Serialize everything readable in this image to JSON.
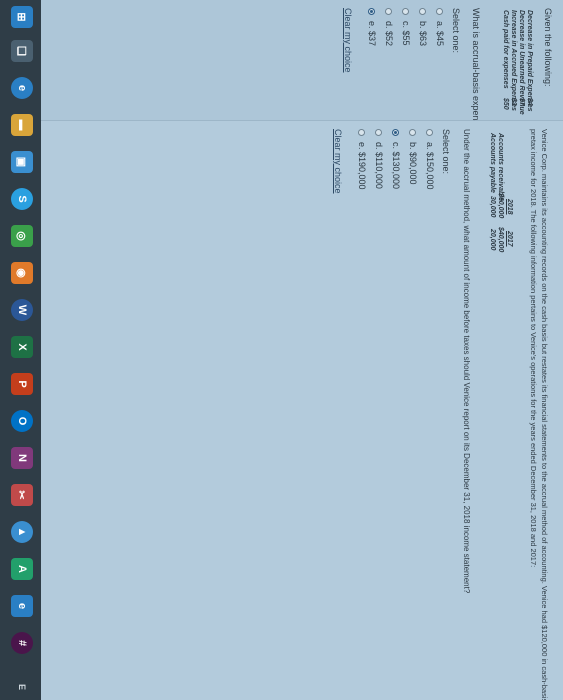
{
  "question1": {
    "title": "Given the following:",
    "table": [
      {
        "label": "Decrease in Prepaid Expenses",
        "value": "$4"
      },
      {
        "label": "Decrease in Unearned Revenue",
        "value": "$7"
      },
      {
        "label": "Increase in Accrued Expenses",
        "value": "$3"
      },
      {
        "label": "Cash paid for expenses",
        "value": "$50"
      }
    ],
    "prompt": "What is accrual-basis expenses?",
    "select_one": "Select one:",
    "options": [
      {
        "label": "a. $45",
        "selected": false
      },
      {
        "label": "b. $63",
        "selected": false
      },
      {
        "label": "c. $55",
        "selected": false
      },
      {
        "label": "d. $52",
        "selected": false
      },
      {
        "label": "e. $37",
        "selected": true
      }
    ],
    "clear": "Clear my choice"
  },
  "question2": {
    "stem_line1": "Venice Corp. maintains its accounting records on the cash basis but restates its financial statements to the accrual method of accounting. Venice had $120,000 in cash-basis",
    "stem_line2": "pretax income for 2018. The following information pertains to Venice's operations for the years ended December 31, 2018 and 2017:",
    "table": {
      "years": [
        "2018",
        "2017"
      ],
      "rows": [
        {
          "label": "Accounts receivable",
          "values": [
            "$60,000",
            "$40,000"
          ]
        },
        {
          "label": "Accounts payable",
          "values": [
            "30,000",
            "20,000"
          ]
        }
      ]
    },
    "prompt": "Under the accrual method, what amount of income before taxes should Venice report on its December 31, 2018 income statement?",
    "select_one": "Select one:",
    "options": [
      {
        "label": "a. $150,000",
        "selected": false
      },
      {
        "label": "b. $90,000",
        "selected": false
      },
      {
        "label": "c. $130,000",
        "selected": true
      },
      {
        "label": "d. $110,000",
        "selected": false
      },
      {
        "label": "e. $190,000",
        "selected": false
      }
    ],
    "clear": "Clear my choice"
  },
  "taskbar": {
    "icons": [
      {
        "name": "task-view-icon",
        "glyph": "❑",
        "color": "#4a6070"
      },
      {
        "name": "edge-icon",
        "glyph": "e",
        "color": "#2a7fc4"
      },
      {
        "name": "file-explorer-icon",
        "glyph": "▬",
        "color": "#d9a53a"
      },
      {
        "name": "store-icon",
        "glyph": "▣",
        "color": "#3a8fd0"
      },
      {
        "name": "skype-icon",
        "glyph": "S",
        "color": "#2aa0e0"
      },
      {
        "name": "chrome-icon",
        "glyph": "◎",
        "color": "#3aa04a"
      },
      {
        "name": "firefox-icon",
        "glyph": "◉",
        "color": "#e07a2a"
      },
      {
        "name": "word-icon",
        "glyph": "W",
        "color": "#2b5797"
      },
      {
        "name": "excel-icon",
        "glyph": "X",
        "color": "#1e7145"
      },
      {
        "name": "powerpoint-icon",
        "glyph": "P",
        "color": "#c43e1c"
      },
      {
        "name": "outlook-icon",
        "glyph": "O",
        "color": "#0072c6"
      },
      {
        "name": "onenote-icon",
        "glyph": "N",
        "color": "#80397b"
      },
      {
        "name": "snipping-icon",
        "glyph": "✂",
        "color": "#c04a4a"
      },
      {
        "name": "photos-icon",
        "glyph": "▲",
        "color": "#3a8fd0"
      },
      {
        "name": "app-icon",
        "glyph": "A",
        "color": "#22a06b"
      },
      {
        "name": "browser-icon",
        "glyph": "e",
        "color": "#2a7fc4"
      },
      {
        "name": "slack-icon",
        "glyph": "#",
        "color": "#4a154b"
      }
    ],
    "right_glyph": "E"
  }
}
